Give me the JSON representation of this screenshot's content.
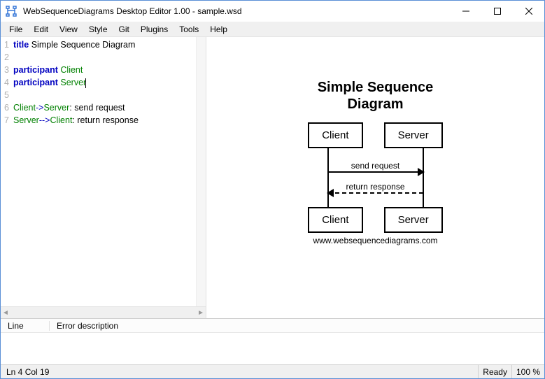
{
  "window": {
    "title": "WebSequenceDiagrams Desktop Editor 1.00 - sample.wsd"
  },
  "menu": {
    "items": [
      "File",
      "Edit",
      "View",
      "Style",
      "Git",
      "Plugins",
      "Tools",
      "Help"
    ]
  },
  "editor": {
    "lines": [
      {
        "n": "1",
        "tokens": [
          [
            "kw",
            "title"
          ],
          [
            "plain",
            " Simple Sequence Diagram"
          ]
        ]
      },
      {
        "n": "2",
        "tokens": []
      },
      {
        "n": "3",
        "tokens": [
          [
            "kw",
            "participant"
          ],
          [
            "plain",
            " "
          ],
          [
            "ident",
            "Client"
          ]
        ]
      },
      {
        "n": "4",
        "tokens": [
          [
            "kw",
            "participant"
          ],
          [
            "plain",
            " "
          ],
          [
            "ident",
            "Server"
          ]
        ],
        "caret": true
      },
      {
        "n": "5",
        "tokens": []
      },
      {
        "n": "6",
        "tokens": [
          [
            "ident",
            "Client"
          ],
          [
            "op",
            "->"
          ],
          [
            "ident",
            "Server"
          ],
          [
            "plain",
            ": send request"
          ]
        ]
      },
      {
        "n": "7",
        "tokens": [
          [
            "ident",
            "Server"
          ],
          [
            "op",
            "-->"
          ],
          [
            "ident",
            "Client"
          ],
          [
            "plain",
            ": return response"
          ]
        ]
      }
    ]
  },
  "diagram": {
    "title_l1": "Simple Sequence",
    "title_l2": "Diagram",
    "p1": "Client",
    "p2": "Server",
    "msg1": "send request",
    "msg2": "return response",
    "watermark": "www.websequencediagrams.com"
  },
  "errors": {
    "col_line": "Line",
    "col_desc": "Error description"
  },
  "status": {
    "position": "Ln 4 Col 19",
    "ready": "Ready",
    "zoom": "100 %"
  },
  "chart_data": {
    "type": "sequence-diagram",
    "title": "Simple Sequence Diagram",
    "participants": [
      "Client",
      "Server"
    ],
    "messages": [
      {
        "from": "Client",
        "to": "Server",
        "label": "send request",
        "style": "solid"
      },
      {
        "from": "Server",
        "to": "Client",
        "label": "return response",
        "style": "dashed"
      }
    ]
  }
}
